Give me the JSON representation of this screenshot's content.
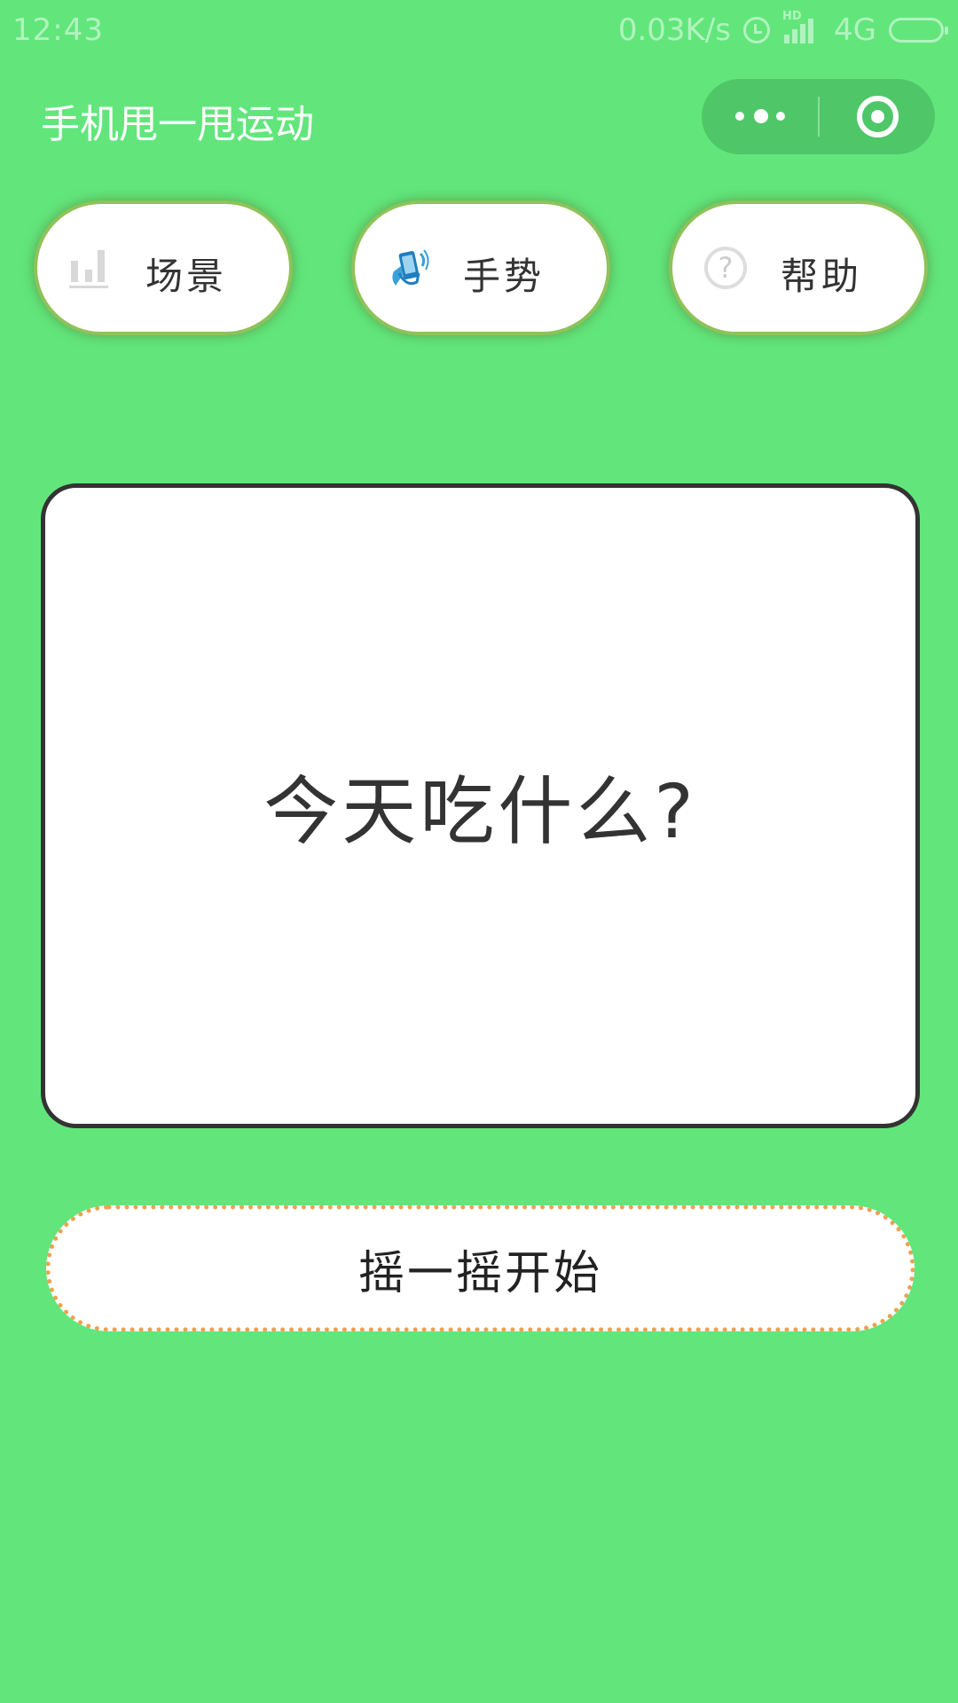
{
  "status_bar": {
    "time": "12:43",
    "network_speed": "0.03K/s",
    "hd_label": "HD",
    "network_type": "4G",
    "icons": [
      "alarm-icon",
      "signal-icon",
      "battery-icon"
    ]
  },
  "nav": {
    "title": "手机甩一甩运动",
    "capsule_icons": [
      "more-icon",
      "target-icon"
    ]
  },
  "tabs": [
    {
      "label": "场景",
      "icon": "bar-chart-icon"
    },
    {
      "label": "手势",
      "icon": "hand-phone-icon"
    },
    {
      "label": "帮助",
      "icon": "help-icon",
      "icon_glyph": "?"
    }
  ],
  "card": {
    "text": "今天吃什么?"
  },
  "start_button": {
    "label": "摇一摇开始"
  },
  "colors": {
    "background": "#62e67c",
    "capsule": "#4fc768",
    "tab_border": "#8fc25a",
    "start_border": "#f0a050",
    "card_border": "#333333"
  }
}
